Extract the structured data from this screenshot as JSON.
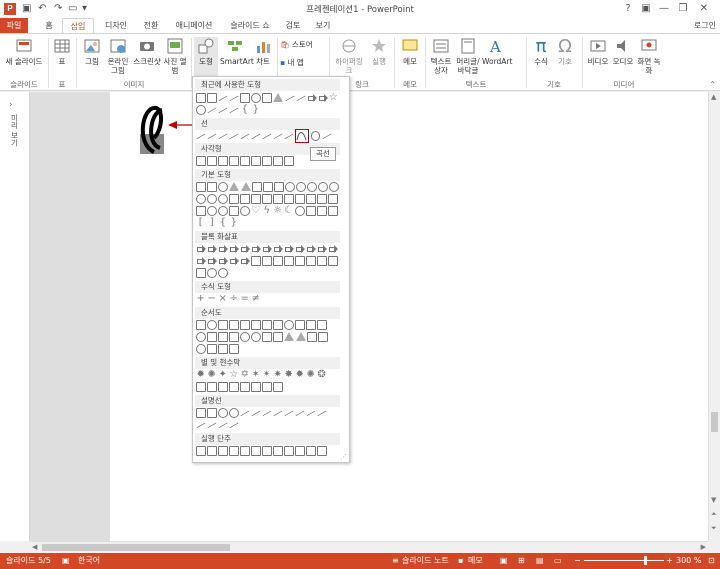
{
  "window": {
    "title": "프레젠테이션1 - PowerPoint",
    "help": "?",
    "login": "로그인"
  },
  "tabs": [
    "파일",
    "홈",
    "삽입",
    "디자인",
    "전환",
    "애니메이션",
    "슬라이드 쇼",
    "검토",
    "보기"
  ],
  "ribbon": {
    "buttons": {
      "new_slide": "새 슬라이드",
      "table": "표",
      "picture": "그림",
      "online_picture": "온라인 그림",
      "screenshot": "스크린샷",
      "album": "사진 앨범",
      "shapes": "도형",
      "smartart": "SmartArt",
      "chart": "차트",
      "store": "스토어",
      "myapps": "내 앱",
      "hyperlink": "하이퍼링크",
      "action": "실행",
      "comment": "메모",
      "textbox": "텍스트 상자",
      "header_footer": "머리글/바닥글",
      "wordart": "WordArt",
      "equation": "수식",
      "symbol": "기호",
      "video": "비디오",
      "audio": "오디오",
      "screen_record": "화면 녹화"
    },
    "groups": {
      "slides": "슬라이드",
      "tables": "표",
      "images": "이미지",
      "links": "링크",
      "comments": "메모",
      "text": "텍스트",
      "symbols": "기호",
      "media": "미디어"
    }
  },
  "shapes_menu": {
    "sections": [
      "최근에 사용한 도형",
      "선",
      "사각형",
      "기본 도형",
      "블록 화살표",
      "수식 도형",
      "순서도",
      "별 및 현수막",
      "설명선",
      "실행 단추"
    ],
    "tooltip": "곡선"
  },
  "left_panel": {
    "label": "미리 보기"
  },
  "statusbar": {
    "slide_info": "슬라이드 5/5",
    "language": "한국어",
    "notes": "슬라이드 노트",
    "comments": "메모",
    "zoom": "300 %"
  },
  "colors": {
    "accent": "#d24726",
    "highlight": "#c00000"
  }
}
